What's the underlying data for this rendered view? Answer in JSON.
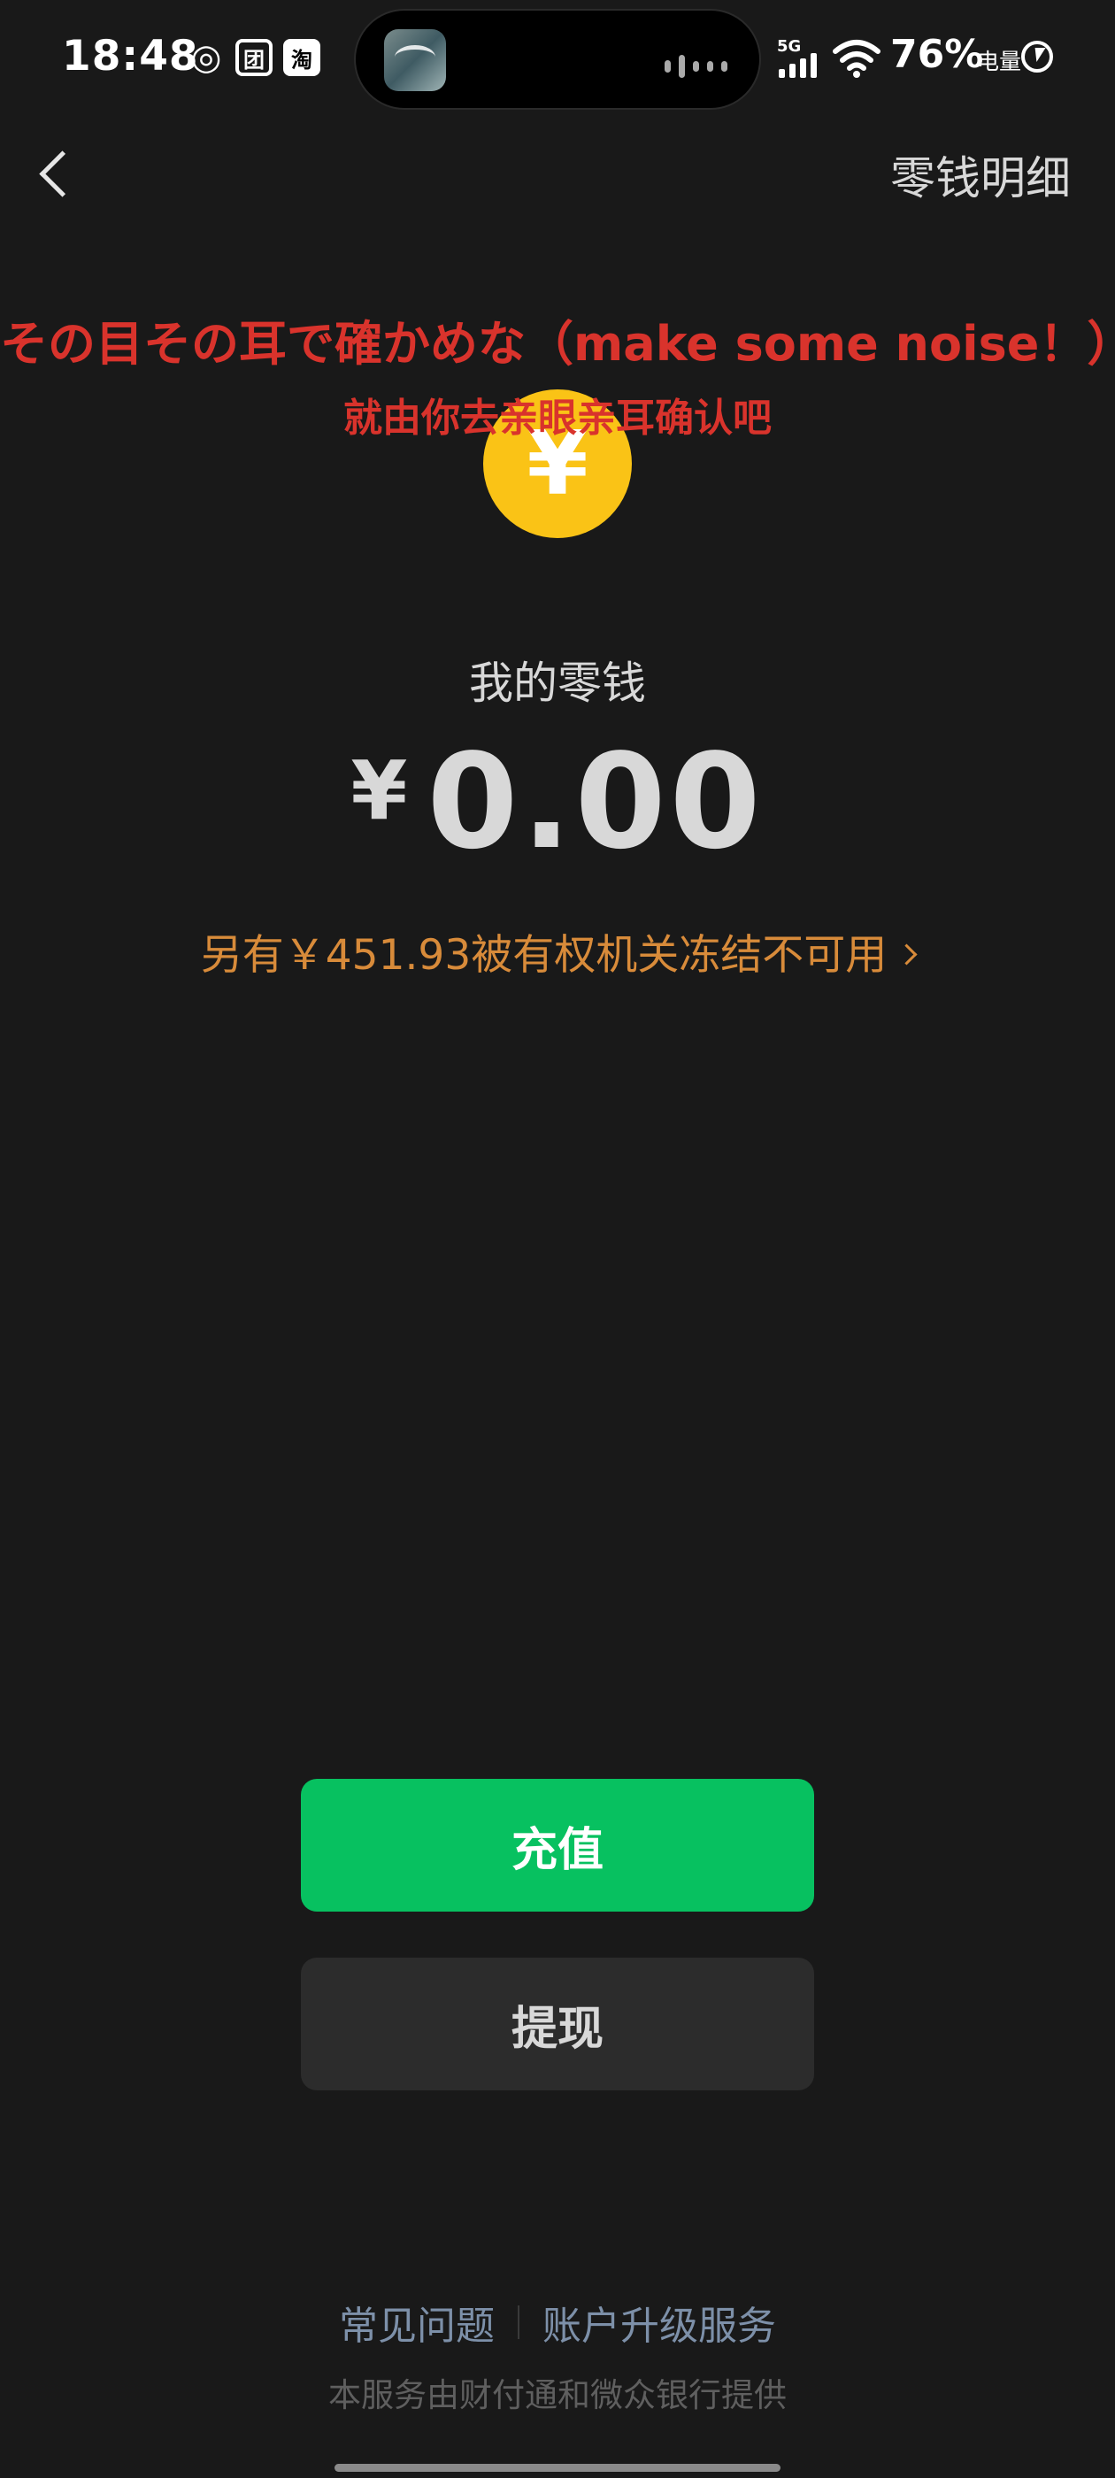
{
  "status_bar": {
    "time": "18:48",
    "network": "5G",
    "battery_percent": "76%",
    "battery_label": "电量",
    "app_icons": [
      "netease-music-icon",
      "meituan-icon",
      "taobao-icon"
    ],
    "app_icon_glyphs": [
      "◎",
      "团",
      "淘"
    ]
  },
  "nav": {
    "title": "零钱明细"
  },
  "caption": {
    "japanese": "その目その耳で確かめな（make some noise！）",
    "chinese": "就由你去亲眼亲耳确认吧"
  },
  "coin": {
    "symbol": "¥",
    "color": "#fac316"
  },
  "balance": {
    "label": "我的零钱",
    "currency": "¥",
    "amount": "0.00",
    "frozen_notice": "另有￥451.93被有权机关冻结不可用"
  },
  "actions": {
    "recharge": "充值",
    "withdraw": "提现",
    "recharge_color": "#07c160"
  },
  "footer": {
    "faq": "常见问题",
    "upgrade": "账户升级服务",
    "provider_note": "本服务由财付通和微众银行提供"
  }
}
